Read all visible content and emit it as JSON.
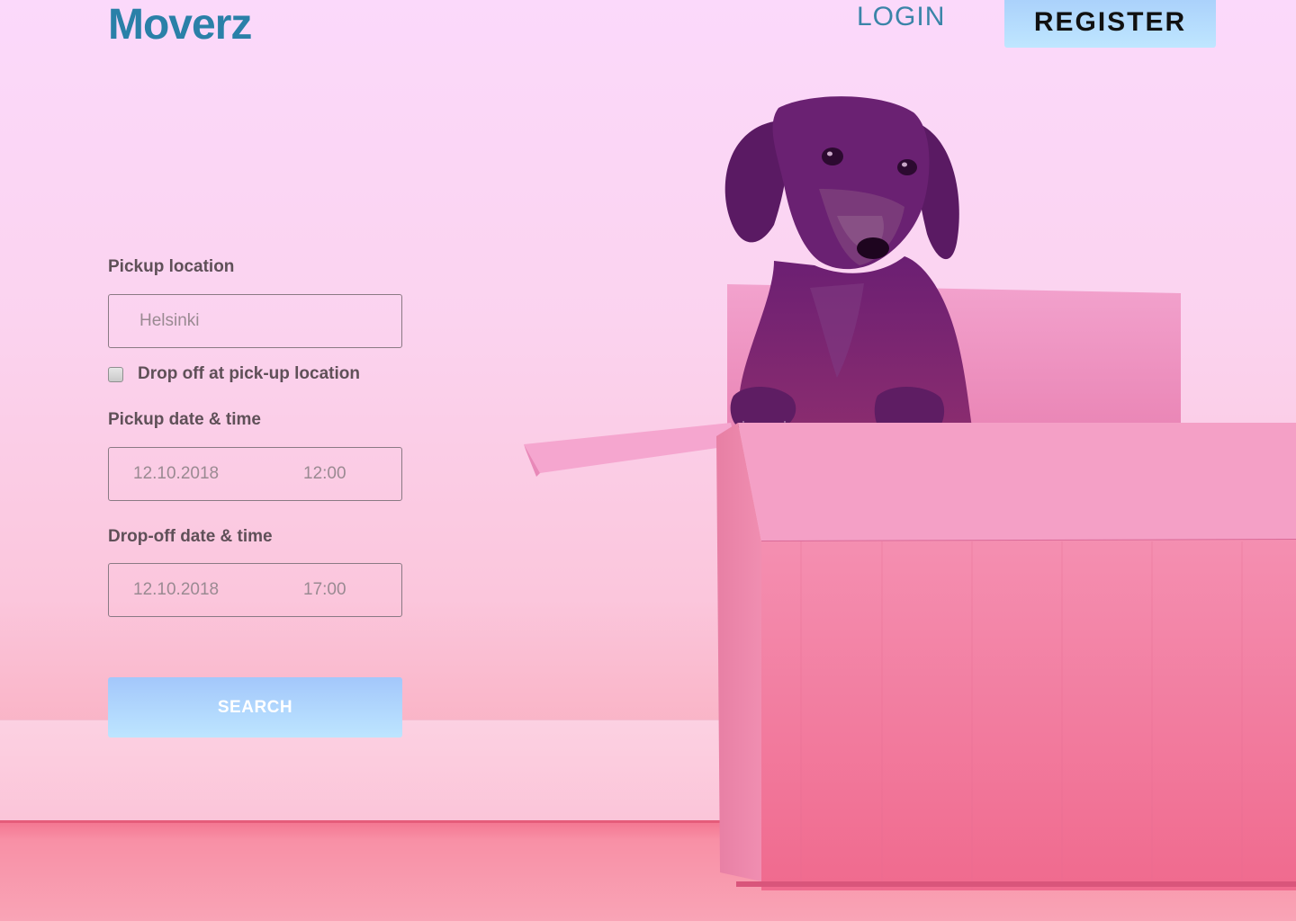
{
  "header": {
    "logo": "Moverz",
    "login_label": "LOGIN",
    "register_label": "REGISTER"
  },
  "form": {
    "pickup_location": {
      "label": "Pickup location",
      "value": "Helsinki"
    },
    "dropoff_same": {
      "label": "Drop off at pick-up location",
      "checked": false
    },
    "pickup_datetime": {
      "label": "Pickup date & time",
      "date": "12.10.2018",
      "time": "12:00"
    },
    "dropoff_datetime": {
      "label": "Drop-off date & time",
      "date": "12.10.2018",
      "time": "17:00"
    },
    "search_label": "SEARCH"
  },
  "hero": {
    "subject": "dachshund-in-cardboard-box"
  },
  "colors": {
    "brand": "#2a80a8",
    "button_gradient_top": "#a3c7fb",
    "button_gradient_bottom": "#bde5ff",
    "label_text": "#5f5058",
    "field_text": "#9a8a92"
  }
}
